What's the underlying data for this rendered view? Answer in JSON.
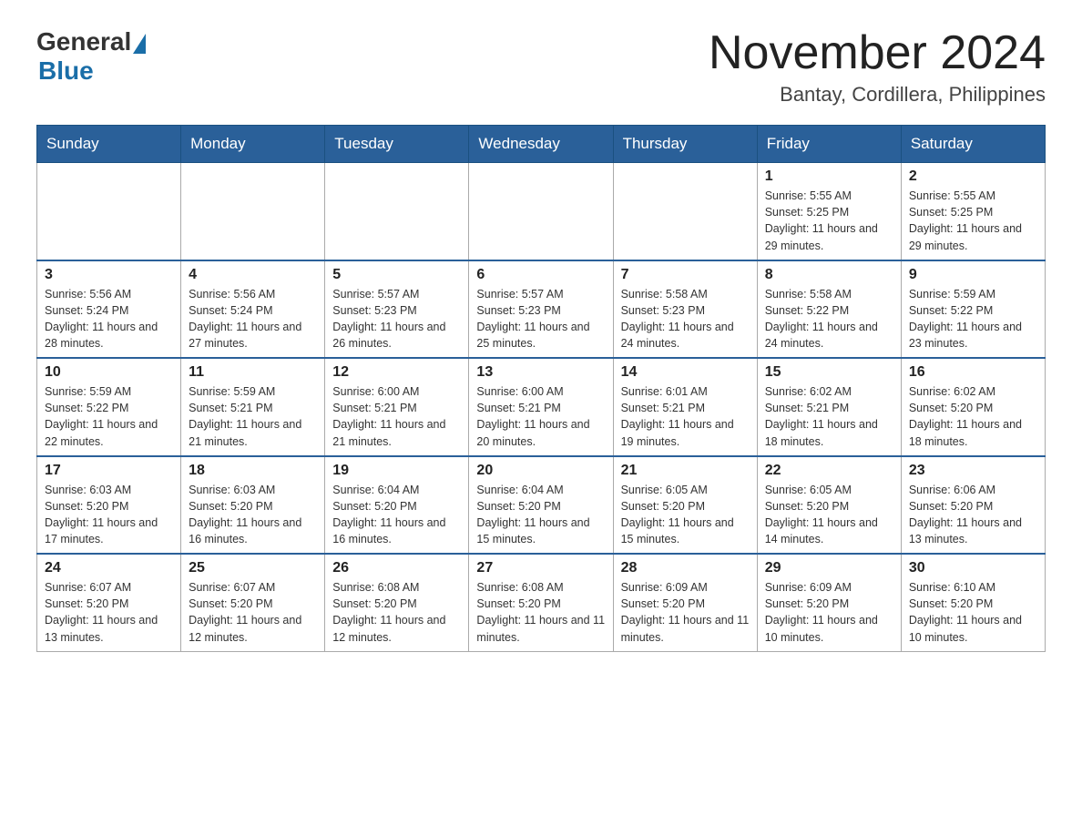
{
  "header": {
    "logo_general": "General",
    "logo_blue": "Blue",
    "month_title": "November 2024",
    "location": "Bantay, Cordillera, Philippines"
  },
  "weekdays": [
    "Sunday",
    "Monday",
    "Tuesday",
    "Wednesday",
    "Thursday",
    "Friday",
    "Saturday"
  ],
  "weeks": [
    [
      {
        "day": "",
        "info": ""
      },
      {
        "day": "",
        "info": ""
      },
      {
        "day": "",
        "info": ""
      },
      {
        "day": "",
        "info": ""
      },
      {
        "day": "",
        "info": ""
      },
      {
        "day": "1",
        "info": "Sunrise: 5:55 AM\nSunset: 5:25 PM\nDaylight: 11 hours and 29 minutes."
      },
      {
        "day": "2",
        "info": "Sunrise: 5:55 AM\nSunset: 5:25 PM\nDaylight: 11 hours and 29 minutes."
      }
    ],
    [
      {
        "day": "3",
        "info": "Sunrise: 5:56 AM\nSunset: 5:24 PM\nDaylight: 11 hours and 28 minutes."
      },
      {
        "day": "4",
        "info": "Sunrise: 5:56 AM\nSunset: 5:24 PM\nDaylight: 11 hours and 27 minutes."
      },
      {
        "day": "5",
        "info": "Sunrise: 5:57 AM\nSunset: 5:23 PM\nDaylight: 11 hours and 26 minutes."
      },
      {
        "day": "6",
        "info": "Sunrise: 5:57 AM\nSunset: 5:23 PM\nDaylight: 11 hours and 25 minutes."
      },
      {
        "day": "7",
        "info": "Sunrise: 5:58 AM\nSunset: 5:23 PM\nDaylight: 11 hours and 24 minutes."
      },
      {
        "day": "8",
        "info": "Sunrise: 5:58 AM\nSunset: 5:22 PM\nDaylight: 11 hours and 24 minutes."
      },
      {
        "day": "9",
        "info": "Sunrise: 5:59 AM\nSunset: 5:22 PM\nDaylight: 11 hours and 23 minutes."
      }
    ],
    [
      {
        "day": "10",
        "info": "Sunrise: 5:59 AM\nSunset: 5:22 PM\nDaylight: 11 hours and 22 minutes."
      },
      {
        "day": "11",
        "info": "Sunrise: 5:59 AM\nSunset: 5:21 PM\nDaylight: 11 hours and 21 minutes."
      },
      {
        "day": "12",
        "info": "Sunrise: 6:00 AM\nSunset: 5:21 PM\nDaylight: 11 hours and 21 minutes."
      },
      {
        "day": "13",
        "info": "Sunrise: 6:00 AM\nSunset: 5:21 PM\nDaylight: 11 hours and 20 minutes."
      },
      {
        "day": "14",
        "info": "Sunrise: 6:01 AM\nSunset: 5:21 PM\nDaylight: 11 hours and 19 minutes."
      },
      {
        "day": "15",
        "info": "Sunrise: 6:02 AM\nSunset: 5:21 PM\nDaylight: 11 hours and 18 minutes."
      },
      {
        "day": "16",
        "info": "Sunrise: 6:02 AM\nSunset: 5:20 PM\nDaylight: 11 hours and 18 minutes."
      }
    ],
    [
      {
        "day": "17",
        "info": "Sunrise: 6:03 AM\nSunset: 5:20 PM\nDaylight: 11 hours and 17 minutes."
      },
      {
        "day": "18",
        "info": "Sunrise: 6:03 AM\nSunset: 5:20 PM\nDaylight: 11 hours and 16 minutes."
      },
      {
        "day": "19",
        "info": "Sunrise: 6:04 AM\nSunset: 5:20 PM\nDaylight: 11 hours and 16 minutes."
      },
      {
        "day": "20",
        "info": "Sunrise: 6:04 AM\nSunset: 5:20 PM\nDaylight: 11 hours and 15 minutes."
      },
      {
        "day": "21",
        "info": "Sunrise: 6:05 AM\nSunset: 5:20 PM\nDaylight: 11 hours and 15 minutes."
      },
      {
        "day": "22",
        "info": "Sunrise: 6:05 AM\nSunset: 5:20 PM\nDaylight: 11 hours and 14 minutes."
      },
      {
        "day": "23",
        "info": "Sunrise: 6:06 AM\nSunset: 5:20 PM\nDaylight: 11 hours and 13 minutes."
      }
    ],
    [
      {
        "day": "24",
        "info": "Sunrise: 6:07 AM\nSunset: 5:20 PM\nDaylight: 11 hours and 13 minutes."
      },
      {
        "day": "25",
        "info": "Sunrise: 6:07 AM\nSunset: 5:20 PM\nDaylight: 11 hours and 12 minutes."
      },
      {
        "day": "26",
        "info": "Sunrise: 6:08 AM\nSunset: 5:20 PM\nDaylight: 11 hours and 12 minutes."
      },
      {
        "day": "27",
        "info": "Sunrise: 6:08 AM\nSunset: 5:20 PM\nDaylight: 11 hours and 11 minutes."
      },
      {
        "day": "28",
        "info": "Sunrise: 6:09 AM\nSunset: 5:20 PM\nDaylight: 11 hours and 11 minutes."
      },
      {
        "day": "29",
        "info": "Sunrise: 6:09 AM\nSunset: 5:20 PM\nDaylight: 11 hours and 10 minutes."
      },
      {
        "day": "30",
        "info": "Sunrise: 6:10 AM\nSunset: 5:20 PM\nDaylight: 11 hours and 10 minutes."
      }
    ]
  ]
}
